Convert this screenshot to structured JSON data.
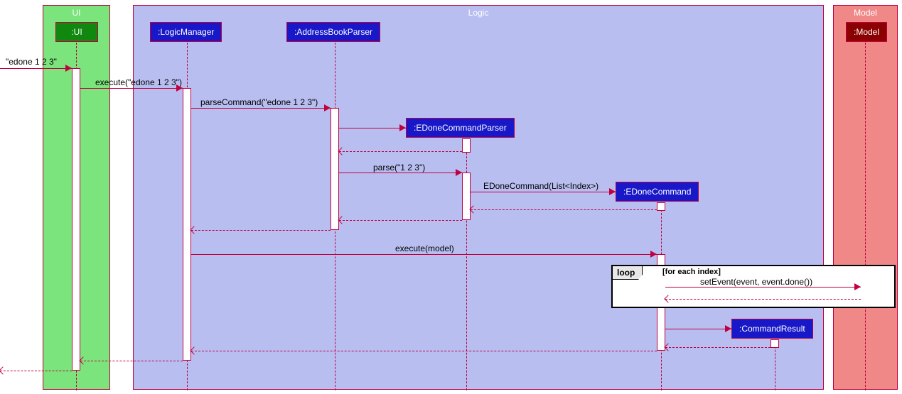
{
  "groups": {
    "ui": {
      "title": "UI"
    },
    "logic": {
      "title": "Logic"
    },
    "model": {
      "title": "Model"
    }
  },
  "participants": {
    "ui": {
      "label": ":UI"
    },
    "logicManager": {
      "label": ":LogicManager"
    },
    "parser": {
      "label": ":AddressBookParser"
    },
    "edoneParser": {
      "label": ":EDoneCommandParser"
    },
    "edoneCmd": {
      "label": ":EDoneCommand"
    },
    "cmdResult": {
      "label": ":CommandResult"
    },
    "model": {
      "label": ":Model"
    }
  },
  "messages": {
    "input": "\"edone 1 2 3\"",
    "execute": "execute(\"edone 1 2 3\")",
    "parseCommand": "parseCommand(\"edone 1 2 3\")",
    "parse": "parse(\"1 2 3\")",
    "edoneCtor": "EDoneCommand(List<Index>)",
    "executeModel": "execute(model)",
    "setEvent": "setEvent(event, event.done())"
  },
  "loop": {
    "title": "loop",
    "guard": "[for each index]"
  },
  "chart_data": {
    "type": "uml-sequence",
    "groups": [
      {
        "name": "UI",
        "color": "#7CE47C",
        "participants": [
          "UI"
        ]
      },
      {
        "name": "Logic",
        "color": "#B8BEF0",
        "participants": [
          "LogicManager",
          "AddressBookParser",
          "EDoneCommandParser",
          "EDoneCommand",
          "CommandResult"
        ]
      },
      {
        "name": "Model",
        "color": "#F08888",
        "participants": [
          "Model"
        ]
      }
    ],
    "participants": [
      {
        "id": "UI",
        "label": ":UI",
        "preexisting": true
      },
      {
        "id": "LogicManager",
        "label": ":LogicManager",
        "preexisting": true
      },
      {
        "id": "AddressBookParser",
        "label": ":AddressBookParser",
        "preexisting": true
      },
      {
        "id": "EDoneCommandParser",
        "label": ":EDoneCommandParser",
        "preexisting": false
      },
      {
        "id": "EDoneCommand",
        "label": ":EDoneCommand",
        "preexisting": false
      },
      {
        "id": "CommandResult",
        "label": ":CommandResult",
        "preexisting": false
      },
      {
        "id": "Model",
        "label": ":Model",
        "preexisting": true
      }
    ],
    "messages": [
      {
        "from": "external",
        "to": "UI",
        "label": "\"edone 1 2 3\"",
        "style": "solid"
      },
      {
        "from": "UI",
        "to": "LogicManager",
        "label": "execute(\"edone 1 2 3\")",
        "style": "solid"
      },
      {
        "from": "LogicManager",
        "to": "AddressBookParser",
        "label": "parseCommand(\"edone 1 2 3\")",
        "style": "solid"
      },
      {
        "from": "AddressBookParser",
        "to": "EDoneCommandParser",
        "label": "",
        "style": "solid",
        "creates": "EDoneCommandParser"
      },
      {
        "from": "EDoneCommandParser",
        "to": "AddressBookParser",
        "label": "",
        "style": "dashed"
      },
      {
        "from": "AddressBookParser",
        "to": "EDoneCommandParser",
        "label": "parse(\"1 2 3\")",
        "style": "solid"
      },
      {
        "from": "EDoneCommandParser",
        "to": "EDoneCommand",
        "label": "EDoneCommand(List<Index>)",
        "style": "solid",
        "creates": "EDoneCommand"
      },
      {
        "from": "EDoneCommand",
        "to": "EDoneCommandParser",
        "label": "",
        "style": "dashed"
      },
      {
        "from": "EDoneCommandParser",
        "to": "AddressBookParser",
        "label": "",
        "style": "dashed"
      },
      {
        "from": "AddressBookParser",
        "to": "LogicManager",
        "label": "",
        "style": "dashed"
      },
      {
        "from": "LogicManager",
        "to": "EDoneCommand",
        "label": "execute(model)",
        "style": "solid"
      },
      {
        "fragment": "loop",
        "guard": "[for each index]",
        "messages": [
          {
            "from": "EDoneCommand",
            "to": "Model",
            "label": "setEvent(event, event.done())",
            "style": "solid"
          },
          {
            "from": "Model",
            "to": "EDoneCommand",
            "label": "",
            "style": "dashed"
          }
        ]
      },
      {
        "from": "EDoneCommand",
        "to": "CommandResult",
        "label": "",
        "style": "solid",
        "creates": "CommandResult"
      },
      {
        "from": "CommandResult",
        "to": "EDoneCommand",
        "label": "",
        "style": "dashed"
      },
      {
        "from": "EDoneCommand",
        "to": "LogicManager",
        "label": "",
        "style": "dashed"
      },
      {
        "from": "LogicManager",
        "to": "UI",
        "label": "",
        "style": "dashed"
      },
      {
        "from": "UI",
        "to": "external",
        "label": "",
        "style": "dashed"
      }
    ]
  }
}
